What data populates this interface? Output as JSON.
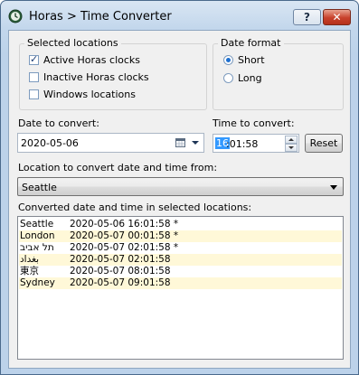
{
  "window": {
    "title": "Horas > Time Converter",
    "help_label": "?",
    "close_label": "✕"
  },
  "selected_locations": {
    "legend": "Selected locations",
    "options": [
      {
        "label": "Active Horas clocks",
        "checked": true
      },
      {
        "label": "Inactive Horas clocks",
        "checked": false
      },
      {
        "label": "Windows locations",
        "checked": false
      }
    ]
  },
  "date_format": {
    "legend": "Date format",
    "options": [
      {
        "label": "Short",
        "selected": true
      },
      {
        "label": "Long",
        "selected": false
      }
    ]
  },
  "date": {
    "label": "Date to convert:",
    "value": "2020-05-06"
  },
  "time": {
    "label": "Time to convert:",
    "selected": "16",
    "rest": ":01:58"
  },
  "reset_label": "Reset",
  "location_from": {
    "label": "Location to convert date and time from:",
    "value": "Seattle"
  },
  "results": {
    "label": "Converted date and time in selected locations:",
    "rows": [
      {
        "location": "Seattle",
        "datetime": "2020-05-06 16:01:58 *"
      },
      {
        "location": "London",
        "datetime": "2020-05-07 00:01:58 *"
      },
      {
        "location": "תל אביב",
        "datetime": "2020-05-07 02:01:58 *"
      },
      {
        "location": "بغداد",
        "datetime": "2020-05-07 02:01:58"
      },
      {
        "location": "東京",
        "datetime": "2020-05-07 08:01:58"
      },
      {
        "location": "Sydney",
        "datetime": "2020-05-07 09:01:58"
      }
    ]
  },
  "colors": {
    "title_bar": "#c3d7ec",
    "client_bg": "#f0f0f0",
    "row_highlight": "#fff8d8",
    "selection": "#3399ff",
    "close_button": "#c8412b"
  }
}
